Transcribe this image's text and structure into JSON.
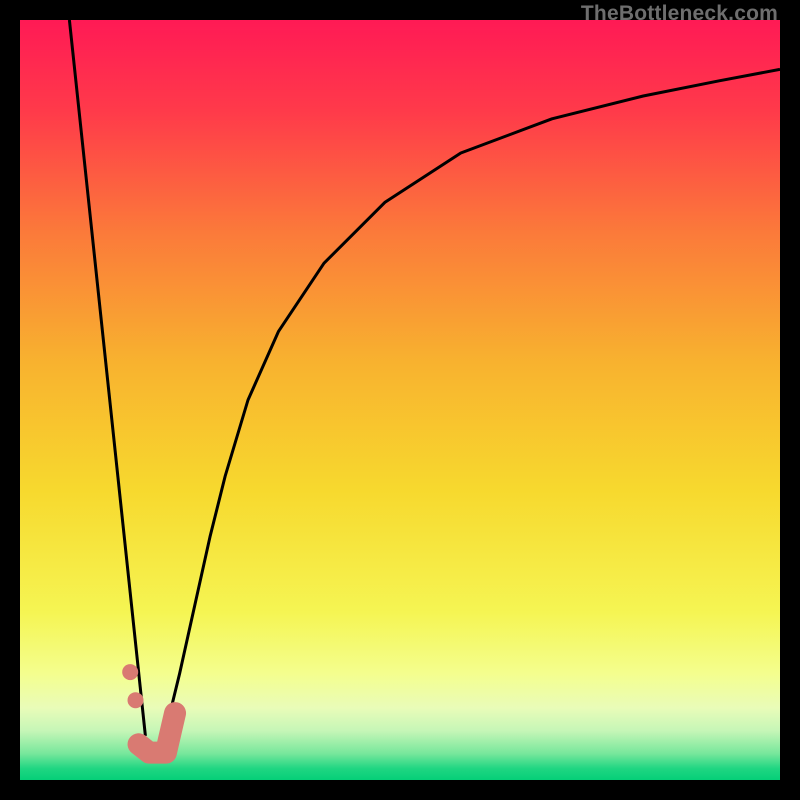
{
  "watermark": {
    "text": "TheBottleneck.com"
  },
  "chart_data": {
    "type": "line",
    "title": "",
    "xlabel": "",
    "ylabel": "",
    "x_range_pct": [
      0,
      100
    ],
    "y_range_pct": [
      0,
      100
    ],
    "gradient_stops": [
      {
        "offset": 0.0,
        "color": "#ff1a55"
      },
      {
        "offset": 0.12,
        "color": "#ff3a4a"
      },
      {
        "offset": 0.28,
        "color": "#fb7a3a"
      },
      {
        "offset": 0.45,
        "color": "#f8b22f"
      },
      {
        "offset": 0.62,
        "color": "#f7d92e"
      },
      {
        "offset": 0.78,
        "color": "#f5f553"
      },
      {
        "offset": 0.86,
        "color": "#f4fe8e"
      },
      {
        "offset": 0.905,
        "color": "#e9fcb8"
      },
      {
        "offset": 0.935,
        "color": "#c6f6b7"
      },
      {
        "offset": 0.965,
        "color": "#78e79c"
      },
      {
        "offset": 0.985,
        "color": "#1fd682"
      },
      {
        "offset": 1.0,
        "color": "#05cf78"
      }
    ],
    "series": [
      {
        "name": "left-branch",
        "type": "line",
        "stroke": "#000000",
        "stroke_width": 3,
        "x": [
          6.5,
          16.5
        ],
        "y": [
          100,
          5.8
        ]
      },
      {
        "name": "right-branch",
        "type": "line",
        "stroke": "#000000",
        "stroke_width": 3,
        "x": [
          19,
          21,
          23,
          25,
          27,
          30,
          34,
          40,
          48,
          58,
          70,
          82,
          92,
          100
        ],
        "y": [
          5.8,
          14,
          23,
          32,
          40,
          50,
          59,
          68,
          76,
          82.5,
          87,
          90,
          92,
          93.5
        ]
      },
      {
        "name": "vertex-marker-stroke",
        "type": "line",
        "stroke": "#d97a72",
        "stroke_width": 22,
        "linecap": "round",
        "x": [
          15.6,
          17.0,
          19.2,
          20.4
        ],
        "y": [
          4.7,
          3.6,
          3.6,
          8.8
        ]
      },
      {
        "name": "vertex-marker-dots",
        "type": "scatter",
        "fill": "#d97a72",
        "r": 8,
        "points": [
          {
            "x": 15.2,
            "y": 10.5
          },
          {
            "x": 14.5,
            "y": 14.2
          }
        ]
      }
    ]
  }
}
